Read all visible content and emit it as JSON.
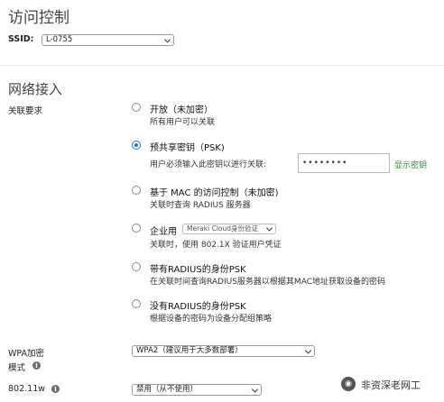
{
  "header": {
    "title": "访问控制"
  },
  "ssid": {
    "label": "SSID:",
    "value": "L-0755"
  },
  "section": {
    "title": "网络接入"
  },
  "association": {
    "label": "关联要求",
    "options": [
      {
        "title": "开放（未加密）",
        "desc": "所有用户可以关联",
        "selected": false
      },
      {
        "title": "预共享密钥（PSK)",
        "desc": "用户必须输入此密钥以进行关联:",
        "selected": true
      },
      {
        "title": "基于 MAC 的访问控制（未加密)",
        "desc": "关联时查询 RADIUS 服务器",
        "selected": false
      },
      {
        "title": "企业用",
        "desc": "关联时，使用 802.1X 验证用户凭证",
        "selected": false
      },
      {
        "title": "带有RADIUS的身份PSK",
        "desc": "在关联时间查询RADIUS服务器以根据其MAC地址获取设备的密码",
        "selected": false
      },
      {
        "title": "没有RADIUS的身份PSK",
        "desc": "根据设备的密码为设备分配组策略",
        "selected": false
      }
    ],
    "psk_value": "••••••••",
    "show_key_label": "显示密钥",
    "enterprise_select": "Meraki Cloud身份验证"
  },
  "wpa": {
    "label_line1": "WPA加密",
    "label_line2": "模式",
    "value": "WPA2（建议用于大多数部署）"
  },
  "dot11w": {
    "label": "802.11w",
    "value": "禁用（从不使用）"
  },
  "watermark": {
    "text": "非资深老网工"
  }
}
